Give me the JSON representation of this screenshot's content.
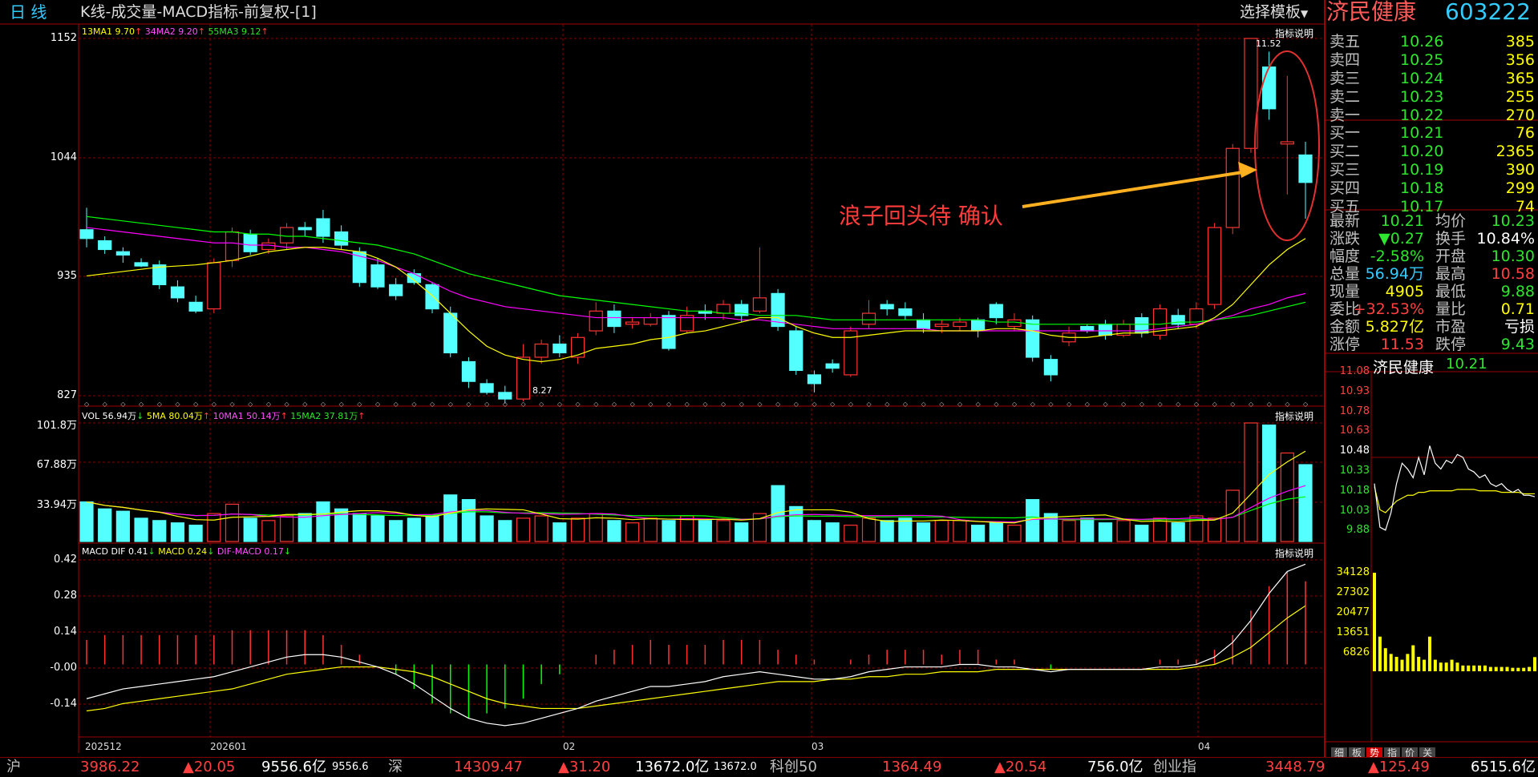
{
  "title_bar": {
    "period_label": "日  线",
    "chart_title": "K线-成交量-MACD指标-前复权-[1]",
    "template_button": "选择模板",
    "stock_name": "济民健康",
    "stock_code": "603222"
  },
  "kline_panel": {
    "legend": {
      "ma13": "13MA1 9.70",
      "ma34": "34MA2 9.20",
      "ma55": "55MA3 9.12"
    },
    "y_ticks": [
      "1152",
      "1044",
      "935",
      "827"
    ],
    "indicator_link": "指标说明",
    "high_label": "11.52",
    "low_label": "8.27",
    "annotation": "浪子回头待 确认"
  },
  "volume_panel": {
    "legend": {
      "vol": "VOL 56.94万",
      "ma5": "5MA 80.04万",
      "ma10": "10MA1 50.14万",
      "ma15": "15MA2 37.81万"
    },
    "y_ticks": [
      "101.8万",
      "67.88万",
      "33.94万"
    ],
    "indicator_link": "指标说明"
  },
  "macd_panel": {
    "legend": {
      "dif": "MACD DIF 0.41",
      "macd": "MACD 0.24",
      "diff": "DIF-MACD 0.17"
    },
    "y_ticks": [
      "0.42",
      "0.28",
      "0.14",
      "-0.00",
      "-0.14"
    ],
    "indicator_link": "指标说明"
  },
  "x_axis_labels": [
    "202512",
    "202601",
    "02",
    "03",
    "04"
  ],
  "order_book": {
    "asks": [
      {
        "label": "卖五",
        "price": "10.26",
        "vol": "385"
      },
      {
        "label": "卖四",
        "price": "10.25",
        "vol": "356"
      },
      {
        "label": "卖三",
        "price": "10.24",
        "vol": "365"
      },
      {
        "label": "卖二",
        "price": "10.23",
        "vol": "255"
      },
      {
        "label": "卖一",
        "price": "10.22",
        "vol": "270"
      }
    ],
    "bids": [
      {
        "label": "买一",
        "price": "10.21",
        "vol": "76"
      },
      {
        "label": "买二",
        "price": "10.20",
        "vol": "2365"
      },
      {
        "label": "买三",
        "price": "10.19",
        "vol": "390"
      },
      {
        "label": "买四",
        "price": "10.18",
        "vol": "299"
      },
      {
        "label": "买五",
        "price": "10.17",
        "vol": "74"
      }
    ]
  },
  "quote_stats": [
    {
      "l1": "最新",
      "v1": "10.21",
      "c1": "g",
      "l2": "均价",
      "v2": "10.23",
      "c2": "g"
    },
    {
      "l1": "涨跌",
      "v1": "▼0.27",
      "c1": "g",
      "l2": "换手",
      "v2": "10.84%",
      "c2": "w"
    },
    {
      "l1": "幅度",
      "v1": "-2.58%",
      "c1": "g",
      "l2": "开盘",
      "v2": "10.30",
      "c2": "g"
    },
    {
      "l1": "总量",
      "v1": "56.94万",
      "c1": "c",
      "l2": "最高",
      "v2": "10.58",
      "c2": "r"
    },
    {
      "l1": "现量",
      "v1": "4905",
      "c1": "y",
      "l2": "最低",
      "v2": "9.88",
      "c2": "g"
    },
    {
      "l1": "委比",
      "v1": "+32.53%",
      "c1": "r",
      "l2": "量比",
      "v2": "0.71",
      "c2": "y"
    },
    {
      "l1": "金额",
      "v1": "5.827亿",
      "c1": "y",
      "l2": "市盈",
      "v2": "亏损",
      "c2": "w"
    },
    {
      "l1": "涨停",
      "v1": "11.53",
      "c1": "r",
      "l2": "跌停",
      "v2": "9.43",
      "c2": "g"
    }
  ],
  "intraday": {
    "title": "济民健康",
    "last": "10.21",
    "price_ticks": [
      "11.08",
      "10.93",
      "10.78",
      "10.63",
      "10.48",
      "10.33",
      "10.18",
      "10.03",
      "9.88"
    ],
    "vol_ticks": [
      "34128",
      "27302",
      "20477",
      "13651",
      "6826"
    ]
  },
  "bottom_tabs": [
    "细",
    "板",
    "势",
    "指",
    "价",
    "关"
  ],
  "status_bar": [
    {
      "label": "沪",
      "index": "3986.22",
      "chg": "▲20.05",
      "amount": "9556.6亿",
      "sub": "9556.6"
    },
    {
      "label": "深",
      "index": "14309.47",
      "chg": "▲31.20",
      "amount": "13672.0亿",
      "sub": "13672.0"
    },
    {
      "label": "科创50",
      "index": "1364.49",
      "chg": "▲20.54",
      "amount": "756.0亿",
      "sub": ""
    },
    {
      "label": "创业指",
      "index": "3448.79",
      "chg": "▲125.49",
      "amount": "6515.6亿",
      "sub": ""
    }
  ],
  "colors": {
    "up": "#ff3232",
    "down": "#54ffff",
    "ma13": "#ffff00",
    "ma34": "#ff00ff",
    "ma55": "#00ff00",
    "grid": "#8b0000"
  },
  "chart_data": {
    "type": "candlestick",
    "candles": [
      [
        9.78,
        9.7,
        9.98,
        9.62
      ],
      [
        9.68,
        9.6,
        9.72,
        9.56
      ],
      [
        9.58,
        9.55,
        9.62,
        9.48
      ],
      [
        9.48,
        9.45,
        9.52,
        9.44
      ],
      [
        9.46,
        9.28,
        9.5,
        9.24
      ],
      [
        9.26,
        9.16,
        9.32,
        9.12
      ],
      [
        9.12,
        9.04,
        9.18,
        9.02
      ],
      [
        9.06,
        9.48,
        9.52,
        9.02
      ],
      [
        9.5,
        9.76,
        9.8,
        9.44
      ],
      [
        9.74,
        9.58,
        9.78,
        9.55
      ],
      [
        9.6,
        9.66,
        9.7,
        9.56
      ],
      [
        9.66,
        9.8,
        9.84,
        9.6
      ],
      [
        9.8,
        9.78,
        9.85,
        9.72
      ],
      [
        9.88,
        9.72,
        9.96,
        9.66
      ],
      [
        9.76,
        9.64,
        9.82,
        9.6
      ],
      [
        9.58,
        9.3,
        9.62,
        9.26
      ],
      [
        9.46,
        9.26,
        9.52,
        9.24
      ],
      [
        9.28,
        9.18,
        9.34,
        9.14
      ],
      [
        9.38,
        9.3,
        9.42,
        9.28
      ],
      [
        9.28,
        9.06,
        9.3,
        9.02
      ],
      [
        9.02,
        8.66,
        9.08,
        8.62
      ],
      [
        8.58,
        8.4,
        8.62,
        8.34
      ],
      [
        8.38,
        8.3,
        8.42,
        8.28
      ],
      [
        8.3,
        8.24,
        8.36,
        8.2
      ],
      [
        8.24,
        8.62,
        8.74,
        8.22
      ],
      [
        8.62,
        8.74,
        8.78,
        8.56
      ],
      [
        8.74,
        8.66,
        8.82,
        8.62
      ],
      [
        8.62,
        8.8,
        8.84,
        8.56
      ],
      [
        8.86,
        9.04,
        9.12,
        8.82
      ],
      [
        9.04,
        8.9,
        9.1,
        8.84
      ],
      [
        8.92,
        8.94,
        8.98,
        8.88
      ],
      [
        8.92,
        8.98,
        9.02,
        8.9
      ],
      [
        9.0,
        8.7,
        9.04,
        8.68
      ],
      [
        8.86,
        9.0,
        9.08,
        8.84
      ],
      [
        9.04,
        9.02,
        9.1,
        8.96
      ],
      [
        9.02,
        9.1,
        9.14,
        8.96
      ],
      [
        9.1,
        9.0,
        9.14,
        8.94
      ],
      [
        9.04,
        9.16,
        9.62,
        9.02
      ],
      [
        9.2,
        8.9,
        9.24,
        8.86
      ],
      [
        8.86,
        8.5,
        8.9,
        8.46
      ],
      [
        8.46,
        8.38,
        8.5,
        8.3
      ],
      [
        8.56,
        8.52,
        8.6,
        8.48
      ],
      [
        8.46,
        8.86,
        8.9,
        8.44
      ],
      [
        8.92,
        9.02,
        9.14,
        8.88
      ],
      [
        9.1,
        9.06,
        9.14,
        9.0
      ],
      [
        9.06,
        9.0,
        9.12,
        8.96
      ],
      [
        8.96,
        8.88,
        9.02,
        8.84
      ],
      [
        8.9,
        8.92,
        8.96,
        8.84
      ],
      [
        8.9,
        8.94,
        8.98,
        8.86
      ],
      [
        8.96,
        8.86,
        8.98,
        8.8
      ],
      [
        9.1,
        8.98,
        9.12,
        8.92
      ],
      [
        8.9,
        8.96,
        9.02,
        8.86
      ],
      [
        8.96,
        8.62,
        9.0,
        8.58
      ],
      [
        8.6,
        8.46,
        8.64,
        8.4
      ],
      [
        8.76,
        8.84,
        8.9,
        8.72
      ],
      [
        8.9,
        8.86,
        8.92,
        8.84
      ],
      [
        8.92,
        8.82,
        8.96,
        8.78
      ],
      [
        8.82,
        8.92,
        8.96,
        8.8
      ],
      [
        8.98,
        8.84,
        9.02,
        8.8
      ],
      [
        8.82,
        9.06,
        9.1,
        8.78
      ],
      [
        9.0,
        8.92,
        9.06,
        8.88
      ],
      [
        8.92,
        9.06,
        9.12,
        8.88
      ],
      [
        9.1,
        9.8,
        9.84,
        9.06
      ],
      [
        9.8,
        10.52,
        10.56,
        9.74
      ],
      [
        10.52,
        11.52,
        11.52,
        10.48
      ],
      [
        11.26,
        10.88,
        11.4,
        10.78
      ],
      [
        10.56,
        10.58,
        11.18,
        10.1
      ],
      [
        10.46,
        10.21,
        10.58,
        9.88
      ]
    ],
    "volume_wan": [
      34,
      28,
      26,
      20,
      18,
      16,
      14,
      24,
      32,
      20,
      18,
      22,
      24,
      34,
      28,
      24,
      22,
      18,
      20,
      22,
      40,
      36,
      22,
      18,
      20,
      22,
      16,
      20,
      24,
      18,
      16,
      20,
      18,
      22,
      18,
      18,
      16,
      24,
      48,
      30,
      18,
      16,
      14,
      20,
      18,
      20,
      16,
      18,
      18,
      14,
      16,
      14,
      36,
      24,
      18,
      20,
      16,
      18,
      14,
      20,
      16,
      22,
      20,
      44,
      101.8,
      100,
      76,
      66,
      60
    ],
    "ma13": [
      9.36,
      9.38,
      9.4,
      9.42,
      9.44,
      9.45,
      9.46,
      9.48,
      9.5,
      9.54,
      9.58,
      9.6,
      9.62,
      9.62,
      9.6,
      9.58,
      9.52,
      9.44,
      9.32,
      9.18,
      9.02,
      8.86,
      8.72,
      8.64,
      8.6,
      8.58,
      8.6,
      8.64,
      8.7,
      8.72,
      8.74,
      8.78,
      8.8,
      8.84,
      8.86,
      8.9,
      8.94,
      8.98,
      8.98,
      8.9,
      8.84,
      8.8,
      8.8,
      8.82,
      8.84,
      8.86,
      8.86,
      8.86,
      8.86,
      8.86,
      8.88,
      8.88,
      8.86,
      8.82,
      8.8,
      8.8,
      8.82,
      8.84,
      8.84,
      8.86,
      8.88,
      8.9,
      8.98,
      9.1,
      9.28,
      9.46,
      9.6,
      9.7
    ],
    "ma34": [
      9.8,
      9.78,
      9.76,
      9.74,
      9.72,
      9.7,
      9.68,
      9.66,
      9.66,
      9.64,
      9.64,
      9.62,
      9.62,
      9.6,
      9.58,
      9.54,
      9.5,
      9.44,
      9.38,
      9.3,
      9.22,
      9.16,
      9.12,
      9.08,
      9.06,
      9.04,
      9.02,
      9.0,
      8.98,
      8.98,
      8.98,
      8.98,
      8.98,
      8.98,
      8.98,
      8.98,
      8.96,
      8.96,
      8.94,
      8.92,
      8.9,
      8.88,
      8.88,
      8.88,
      8.88,
      8.88,
      8.88,
      8.86,
      8.86,
      8.86,
      8.86,
      8.86,
      8.86,
      8.86,
      8.86,
      8.86,
      8.86,
      8.86,
      8.86,
      8.88,
      8.9,
      8.92,
      8.96,
      9.0,
      9.06,
      9.1,
      9.16,
      9.2
    ],
    "ma55": [
      9.9,
      9.88,
      9.86,
      9.84,
      9.82,
      9.8,
      9.78,
      9.76,
      9.76,
      9.74,
      9.74,
      9.72,
      9.72,
      9.7,
      9.68,
      9.66,
      9.64,
      9.6,
      9.56,
      9.5,
      9.44,
      9.38,
      9.34,
      9.3,
      9.26,
      9.22,
      9.18,
      9.16,
      9.14,
      9.12,
      9.1,
      9.08,
      9.06,
      9.04,
      9.04,
      9.02,
      9.02,
      9.0,
      9.0,
      9.0,
      8.98,
      8.96,
      8.96,
      8.96,
      8.96,
      8.96,
      8.96,
      8.96,
      8.96,
      8.96,
      8.94,
      8.94,
      8.92,
      8.92,
      8.92,
      8.92,
      8.92,
      8.92,
      8.92,
      8.92,
      8.94,
      8.94,
      8.96,
      8.98,
      9.0,
      9.04,
      9.08,
      9.12
    ],
    "dif": [
      -0.14,
      -0.12,
      -0.1,
      -0.09,
      -0.08,
      -0.07,
      -0.06,
      -0.05,
      -0.03,
      -0.01,
      0.01,
      0.03,
      0.04,
      0.04,
      0.03,
      0.01,
      -0.01,
      -0.04,
      -0.08,
      -0.13,
      -0.18,
      -0.22,
      -0.24,
      -0.25,
      -0.24,
      -0.22,
      -0.2,
      -0.18,
      -0.15,
      -0.13,
      -0.11,
      -0.09,
      -0.09,
      -0.08,
      -0.07,
      -0.05,
      -0.04,
      -0.03,
      -0.04,
      -0.05,
      -0.06,
      -0.06,
      -0.05,
      -0.03,
      -0.02,
      -0.01,
      -0.01,
      -0.01,
      0.0,
      0.0,
      -0.01,
      -0.01,
      -0.02,
      -0.03,
      -0.02,
      -0.02,
      -0.02,
      -0.02,
      -0.02,
      -0.01,
      -0.01,
      0.0,
      0.03,
      0.09,
      0.18,
      0.29,
      0.38,
      0.41
    ],
    "dea": [
      -0.19,
      -0.18,
      -0.16,
      -0.15,
      -0.14,
      -0.13,
      -0.12,
      -0.11,
      -0.1,
      -0.08,
      -0.06,
      -0.04,
      -0.03,
      -0.02,
      -0.01,
      -0.01,
      -0.01,
      -0.02,
      -0.03,
      -0.05,
      -0.08,
      -0.11,
      -0.14,
      -0.16,
      -0.17,
      -0.18,
      -0.18,
      -0.18,
      -0.17,
      -0.16,
      -0.15,
      -0.14,
      -0.13,
      -0.12,
      -0.11,
      -0.1,
      -0.09,
      -0.08,
      -0.07,
      -0.07,
      -0.07,
      -0.06,
      -0.06,
      -0.05,
      -0.05,
      -0.04,
      -0.04,
      -0.03,
      -0.03,
      -0.03,
      -0.02,
      -0.02,
      -0.02,
      -0.02,
      -0.02,
      -0.02,
      -0.02,
      -0.02,
      -0.02,
      -0.02,
      -0.02,
      -0.01,
      0.0,
      0.03,
      0.07,
      0.13,
      0.19,
      0.24
    ],
    "intraday_price": [
      10.3,
      10.0,
      9.98,
      10.1,
      10.3,
      10.44,
      10.4,
      10.34,
      10.48,
      10.36,
      10.56,
      10.44,
      10.4,
      10.46,
      10.44,
      10.5,
      10.48,
      10.4,
      10.38,
      10.34,
      10.36,
      10.3,
      10.28,
      10.3,
      10.26,
      10.24,
      10.26,
      10.22,
      10.22,
      10.21
    ],
    "intraday_avg": [
      10.28,
      10.12,
      10.1,
      10.14,
      10.18,
      10.2,
      10.22,
      10.22,
      10.24,
      10.24,
      10.25,
      10.25,
      10.25,
      10.25,
      10.25,
      10.26,
      10.26,
      10.26,
      10.26,
      10.25,
      10.25,
      10.25,
      10.25,
      10.24,
      10.24,
      10.24,
      10.24,
      10.23,
      10.23,
      10.23
    ],
    "intraday_vol": [
      34128,
      12000,
      8000,
      6000,
      5000,
      4000,
      6000,
      9000,
      5000,
      4000,
      12000,
      4000,
      3000,
      3000,
      4000,
      3000,
      2000,
      2000,
      2000,
      2000,
      2000,
      1500,
      1500,
      1500,
      1500,
      1200,
      1200,
      1200,
      1500,
      4905
    ],
    "price_ylim": [
      8.27,
      11.52
    ],
    "volume_ylim_wan": [
      0,
      101.8
    ],
    "macd_ylim": [
      -0.28,
      0.46
    ],
    "intraday_ylim": [
      9.88,
      11.08
    ]
  }
}
